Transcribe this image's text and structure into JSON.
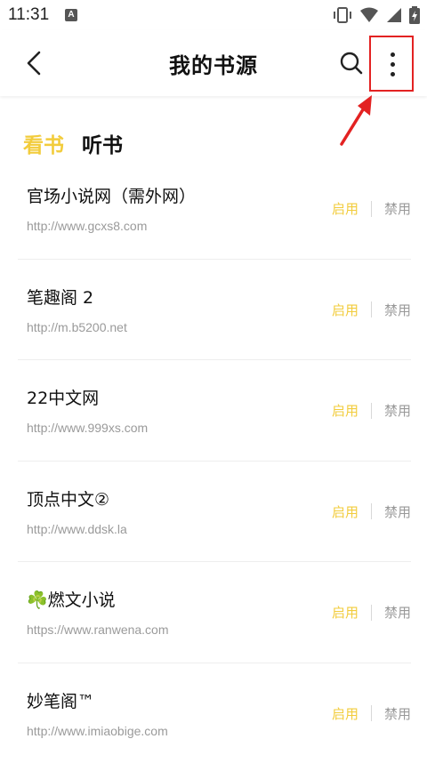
{
  "status_bar": {
    "time": "11:31",
    "badge": "A"
  },
  "app_bar": {
    "title": "我的书源"
  },
  "tabs": [
    {
      "label": "看书",
      "active": true
    },
    {
      "label": "听书",
      "active": false
    }
  ],
  "sources": [
    {
      "name": "官场小说网（需外网）",
      "url": "http://www.gcxs8.com",
      "enable_label": "启用",
      "disable_label": "禁用"
    },
    {
      "name": "笔趣阁 2",
      "url": "http://m.b5200.net",
      "enable_label": "启用",
      "disable_label": "禁用"
    },
    {
      "name": "22中文网",
      "url": "http://www.999xs.com",
      "enable_label": "启用",
      "disable_label": "禁用"
    },
    {
      "name": "顶点中文②",
      "url": "http://www.ddsk.la",
      "enable_label": "启用",
      "disable_label": "禁用"
    },
    {
      "name": "☘️燃文小说",
      "url": "https://www.ranwena.com",
      "enable_label": "启用",
      "disable_label": "禁用"
    },
    {
      "name": "妙笔阁™",
      "url": "http://www.imiaobige.com",
      "enable_label": "启用",
      "disable_label": "禁用"
    }
  ],
  "colors": {
    "accent": "#f2cc3c",
    "annotation": "#e32222",
    "muted": "#999999"
  }
}
